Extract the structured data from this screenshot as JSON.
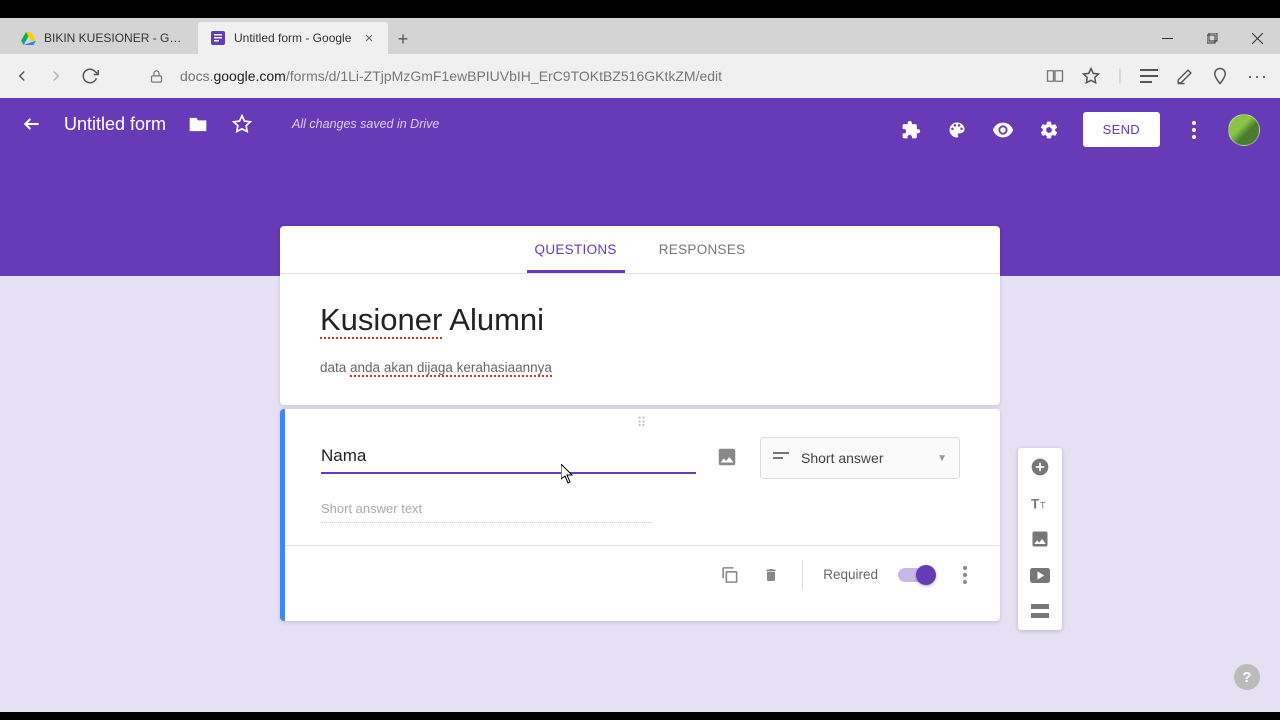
{
  "browser": {
    "tabs": [
      {
        "title": "BIKIN KUESIONER - Google",
        "active": false
      },
      {
        "title": "Untitled form - Google",
        "active": true
      }
    ],
    "url_prefix": "docs.",
    "url_domain": "google.com",
    "url_path": "/forms/d/1Li-ZTjpMzGmF1ewBPIUVbIH_ErC9TOKtBZ516GKtkZM/edit"
  },
  "header": {
    "form_name": "Untitled form",
    "save_status": "All changes saved in Drive",
    "send_label": "SEND"
  },
  "tabs": {
    "questions": "QUESTIONS",
    "responses": "RESPONSES"
  },
  "form": {
    "title_word1": "Kusioner",
    "title_word2": " Alumni",
    "desc_plain": "data ",
    "desc_spell": "anda akan dijaga kerahasiaannya"
  },
  "question": {
    "title": "Nama",
    "type_label": "Short answer",
    "placeholder": "Short answer text",
    "required_label": "Required"
  }
}
